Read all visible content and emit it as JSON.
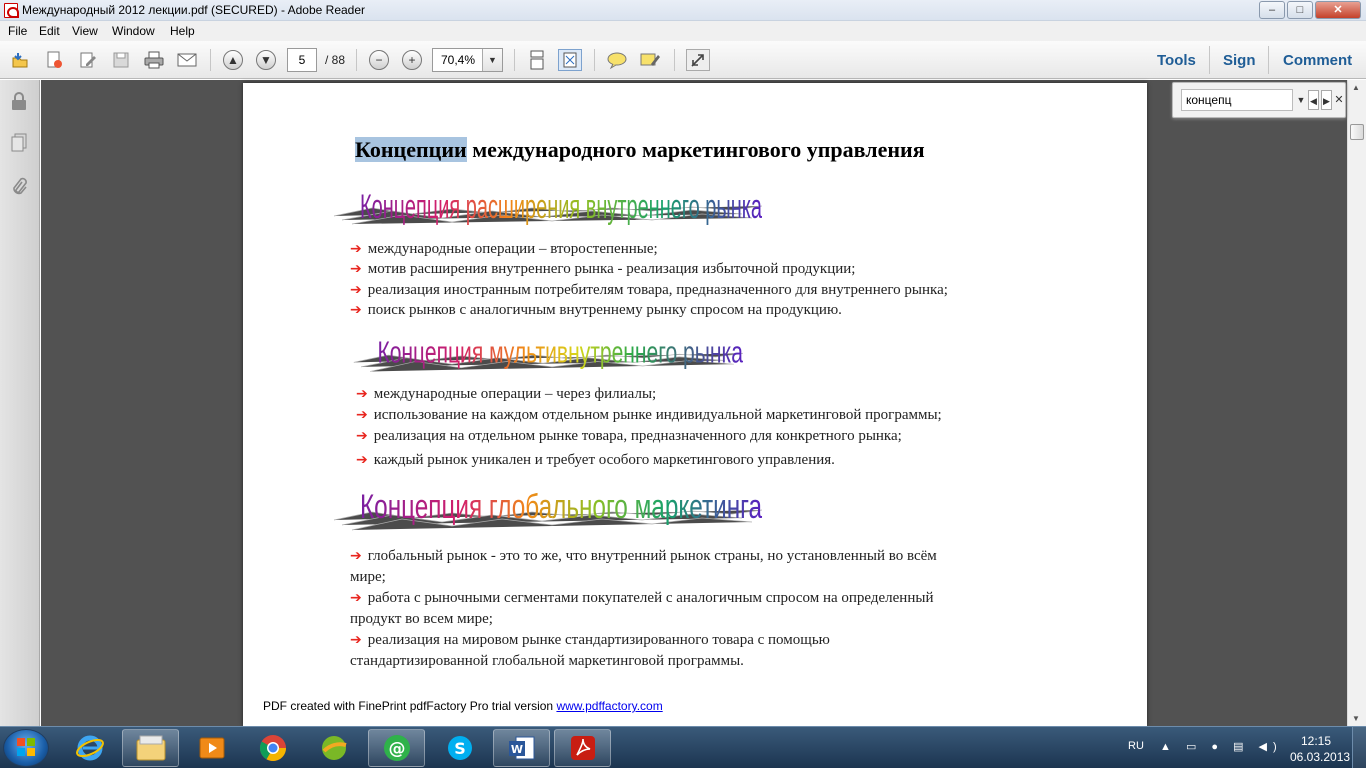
{
  "window": {
    "title": "Международный 2012 лекции.pdf (SECURED) - Adobe Reader",
    "controls": {
      "minimize": "–",
      "maximize": "□",
      "close": "✕"
    }
  },
  "menubar": [
    "File",
    "Edit",
    "View",
    "Window",
    "Help"
  ],
  "toolbar": {
    "page_current": "5",
    "page_total": "/ 88",
    "zoom": "70,4%",
    "links": {
      "tools": "Tools",
      "sign": "Sign",
      "comment": "Comment"
    }
  },
  "find": {
    "query": "концепц"
  },
  "document": {
    "title_highlight": "Концепции",
    "title_rest": " международного маркетингового управления",
    "sections": [
      {
        "heading": "Концепция расширения внутреннего рынка",
        "items": [
          "международные операции – второстепенные;",
          "мотив расширения внутреннего рынка - реализация избыточной продукции;",
          "реализация иностранным потребителям товара, предназначенного для внутреннего рынка;",
          "поиск рынков с аналогичным внутреннему рынку спросом на продукцию."
        ]
      },
      {
        "heading": "Концепция мультивнутреннего рынка",
        "items": [
          "международные операции – через филиалы;",
          "использование на каждом отдельном рынке индивидуальной маркетинговой программы;",
          "реализация на отдельном рынке товара, предназначенного для конкретного рынка;",
          "каждый рынок уникален и требует особого маркетингового управления."
        ]
      },
      {
        "heading": "Концепция глобального маркетинга",
        "items": [
          {
            "line1": "глобальный рынок - это то же, что внутренний рынок страны, но установленный во всём",
            "line2": "мире;"
          },
          {
            "line1": "работа с рыночными сегментами покупателей с аналогичным спросом на определенный",
            "line2": "продукт во всем мире;"
          },
          {
            "line1": "реализация на мировом рынке  стандартизированного товара с помощью",
            "line2": "стандартизированной глобальной маркетинговой программы."
          }
        ]
      }
    ],
    "footer_text": "PDF created with FinePrint pdfFactory Pro trial version ",
    "footer_link": "www.pdffactory.com"
  },
  "taskbar": {
    "lang": "RU",
    "time": "12:15",
    "date": "06.03.2013"
  }
}
